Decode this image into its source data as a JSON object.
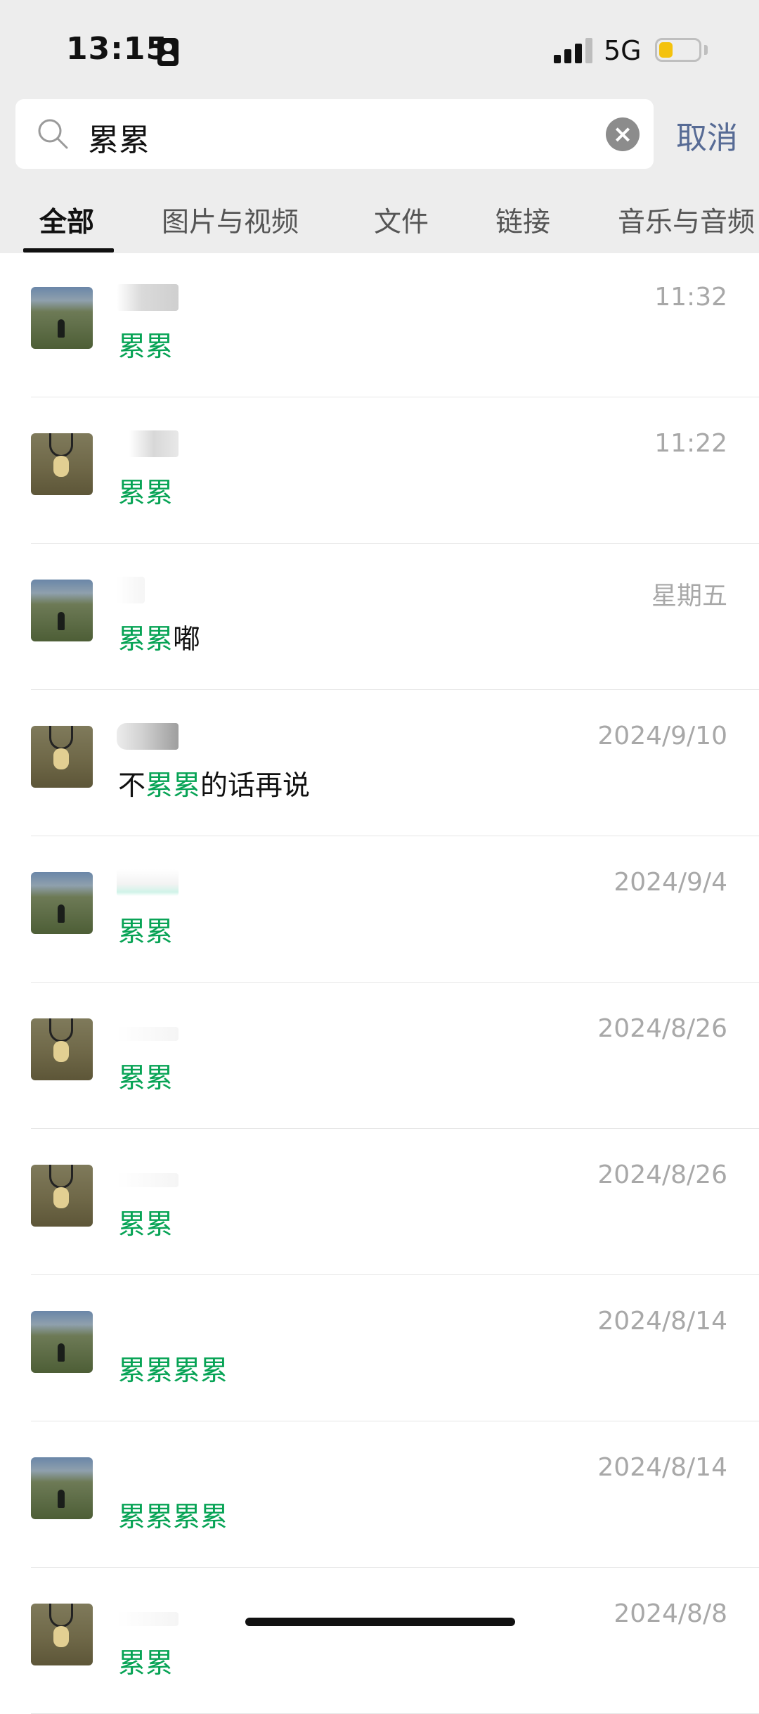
{
  "status_bar": {
    "time": "13:15",
    "network": "5G",
    "battery_level": 0.35
  },
  "search": {
    "query": "累累",
    "cancel_label": "取消"
  },
  "tabs": [
    {
      "label": "全部",
      "active": true
    },
    {
      "label": "图片与视频",
      "active": false
    },
    {
      "label": "文件",
      "active": false
    },
    {
      "label": "链接",
      "active": false
    },
    {
      "label": "音乐与音频",
      "active": false
    }
  ],
  "results": [
    {
      "avatar": "field-photo-avatar",
      "snippet": [
        {
          "text": "累累",
          "hl": true
        }
      ],
      "date": "11:32"
    },
    {
      "avatar": "teddy-bear-avatar",
      "snippet": [
        {
          "text": "累累",
          "hl": true
        }
      ],
      "date": "11:22"
    },
    {
      "avatar": "field-photo-avatar",
      "snippet": [
        {
          "text": "累累",
          "hl": true
        },
        {
          "text": "嘟",
          "hl": false
        }
      ],
      "date": "星期五"
    },
    {
      "avatar": "teddy-bear-avatar",
      "snippet": [
        {
          "text": "不",
          "hl": false
        },
        {
          "text": "累累",
          "hl": true
        },
        {
          "text": "的话再说",
          "hl": false
        }
      ],
      "date": "2024/9/10"
    },
    {
      "avatar": "field-photo-avatar",
      "snippet": [
        {
          "text": "累累",
          "hl": true
        }
      ],
      "date": "2024/9/4"
    },
    {
      "avatar": "teddy-bear-avatar",
      "snippet": [
        {
          "text": "累累",
          "hl": true
        }
      ],
      "date": "2024/8/26"
    },
    {
      "avatar": "teddy-bear-avatar",
      "snippet": [
        {
          "text": "累累",
          "hl": true
        }
      ],
      "date": "2024/8/26"
    },
    {
      "avatar": "field-photo-avatar",
      "snippet": [
        {
          "text": "累累累累",
          "hl": true
        }
      ],
      "date": "2024/8/14"
    },
    {
      "avatar": "field-photo-avatar",
      "snippet": [
        {
          "text": "累累累累",
          "hl": true
        }
      ],
      "date": "2024/8/14"
    },
    {
      "avatar": "teddy-bear-avatar",
      "snippet": [
        {
          "text": "累累",
          "hl": true
        }
      ],
      "date": "2024/8/8"
    }
  ],
  "colors": {
    "highlight": "#07a355",
    "link": "#576b95",
    "header_bg": "#ededed",
    "date": "#a8a8a8"
  }
}
